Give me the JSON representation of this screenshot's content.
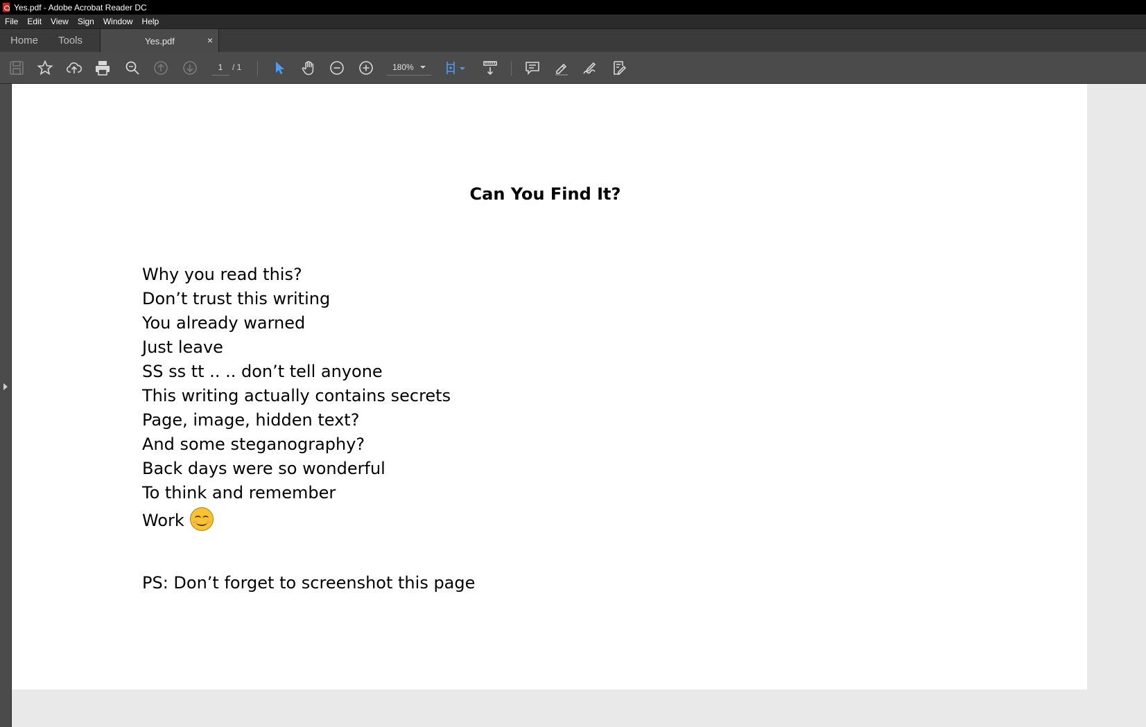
{
  "window": {
    "title": "Yes.pdf - Adobe Acrobat Reader DC"
  },
  "menu": {
    "items": [
      "File",
      "Edit",
      "View",
      "Sign",
      "Window",
      "Help"
    ]
  },
  "tabs": {
    "home": "Home",
    "tools": "Tools",
    "document": "Yes.pdf",
    "close": "×"
  },
  "toolbar": {
    "page_current": "1",
    "page_total": "/ 1",
    "zoom": "180%",
    "accent_color": "#4c9bf5"
  },
  "document": {
    "title": "Can You Find It?",
    "lines": [
      "Why you read this?",
      "Don’t trust this writing",
      "You already warned",
      "Just leave",
      "SS ss tt .. .. don’t tell anyone",
      "This writing actually contains secrets",
      "Page, image, hidden text?",
      "And some steganography?",
      "Back days were so wonderful",
      "To think and remember",
      "Work"
    ],
    "emoji_icon": "smiling-face-icon",
    "ps": "PS: Don’t forget to screenshot this page"
  }
}
